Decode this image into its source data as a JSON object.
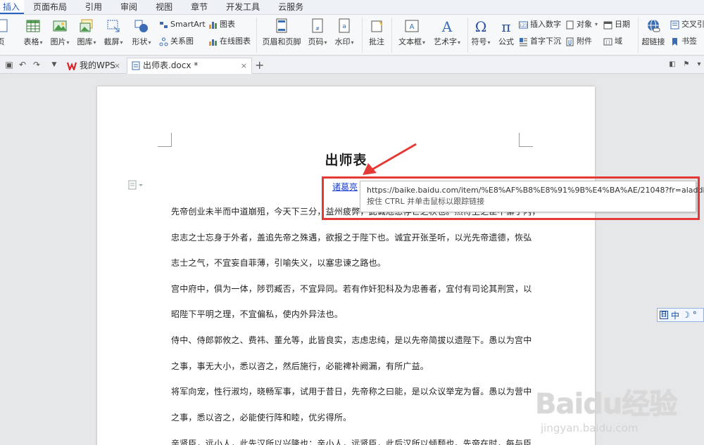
{
  "menu": {
    "tabs": [
      "插入",
      "页面布局",
      "引用",
      "审阅",
      "视图",
      "章节",
      "开发工具",
      "云服务"
    ],
    "active": "插入"
  },
  "ribbon": {
    "buttons": [
      {
        "label": "页",
        "icon": "page-icon"
      },
      {
        "label": "表格",
        "icon": "table-icon"
      },
      {
        "label": "图片",
        "icon": "picture-icon"
      },
      {
        "label": "图库",
        "icon": "gallery-icon"
      },
      {
        "label": "截屏",
        "icon": "screenshot-icon"
      },
      {
        "label": "形状",
        "icon": "shape-icon"
      },
      {
        "label": "页眉和页脚",
        "icon": "header-footer-icon"
      },
      {
        "label": "页码",
        "icon": "page-number-icon"
      },
      {
        "label": "水印",
        "icon": "watermark-icon"
      },
      {
        "label": "批注",
        "icon": "comment-icon"
      },
      {
        "label": "文本框",
        "icon": "textbox-icon"
      },
      {
        "label": "艺术字",
        "icon": "wordart-icon"
      },
      {
        "label": "符号",
        "icon": "omega-icon"
      },
      {
        "label": "公式",
        "icon": "pi-icon"
      },
      {
        "label": "超链接",
        "icon": "hyperlink-icon"
      }
    ],
    "small": {
      "smartart": "SmartArt",
      "chart": "图表",
      "relation": "关系图",
      "online_chart": "在线图表",
      "insert_number": "插入数字",
      "object": "对象",
      "date": "日期",
      "dropcap": "首字下沉",
      "attachment": "附件",
      "field": "域",
      "crossref": "交叉引",
      "bookmark": "书签"
    }
  },
  "tabs": {
    "home": "我的WPS",
    "doc": "出师表.docx *"
  },
  "document": {
    "title": "出师表",
    "author": "诸葛亮",
    "lines": [
      "先帝创业未半而中道崩殂，今天下三分，益州疲弊，此诚危急存亡之秋也。然侍卫之臣不懈于内，",
      "忠志之士忘身于外者，盖追先帝之殊遇，欲报之于陛下也。诚宜开张圣听，以光先帝遗德，恢弘",
      "志士之气，不宜妄自菲薄，引喻失义，以塞忠谏之路也。",
      "宫中府中，俱为一体，陟罚臧否，不宜异同。若有作奸犯科及为忠善者，宜付有司论其刑赏，以",
      "昭陛下平明之理，不宜偏私，使内外异法也。",
      "侍中、侍郎郭攸之、费祎、董允等，此皆良实，志虑忠纯，是以先帝简拔以遗陛下。愚以为宫中",
      "之事，事无大小，悉以咨之，然后施行，必能裨补阙漏，有所广益。",
      "将军向宠，性行淑均，晓畅军事，试用于昔日，先帝称之曰能，是以众议举宠为督。愚以为营中",
      "之事，悉以咨之，必能使行阵和睦，优劣得所。",
      "亲贤臣，远小人，此先汉所以兴隆也；亲小人，远贤臣，此后汉所以倾颓也。先帝在时，每与臣"
    ]
  },
  "tooltip": {
    "url": "https://baike.baidu.com/item/%E8%AF%B8%E8%91%9B%E4%BA%AE/21048?fr=aladdin",
    "hint": "按住 CTRL 并单击鼠标以跟踪链接"
  },
  "ime": {
    "mode": "中"
  },
  "watermark": {
    "logo": "Baidu经验",
    "url": "jingyan.baidu.com"
  }
}
